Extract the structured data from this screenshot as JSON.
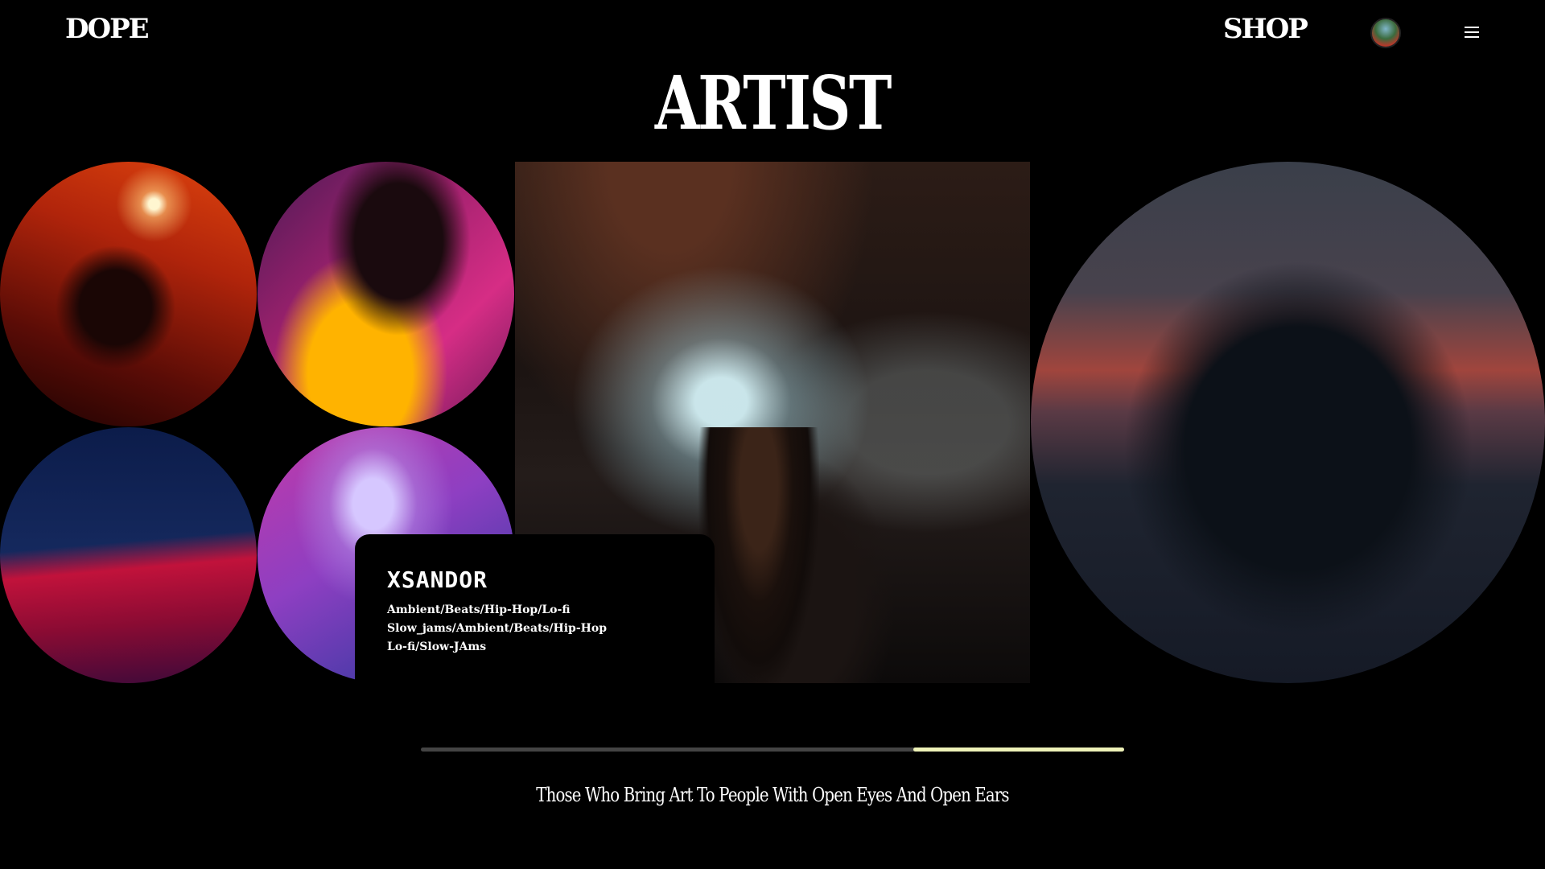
{
  "header": {
    "logo": "DOPE",
    "shop_label": "SHOP",
    "avatar_icon": "user-avatar",
    "menu_icon": "hamburger-menu-icon"
  },
  "page_title": "ARTIST",
  "gallery": {
    "featured": {
      "artist_name": "XSANDOR",
      "genres_line1": "Ambient/Beats/Hip-Hop/Lo-fi",
      "genres_line2": "Slow_jams/Ambient/Beats/Hip-Hop",
      "genres_line3": "Lo-fi/Slow-JAms"
    }
  },
  "carousel": {
    "progress_start": 0.7,
    "progress_end": 1.0,
    "fill_color": "#eef2b8",
    "track_color": "#444444"
  },
  "tagline": "Those Who Bring Art To People With Open Eyes And Open Ears"
}
